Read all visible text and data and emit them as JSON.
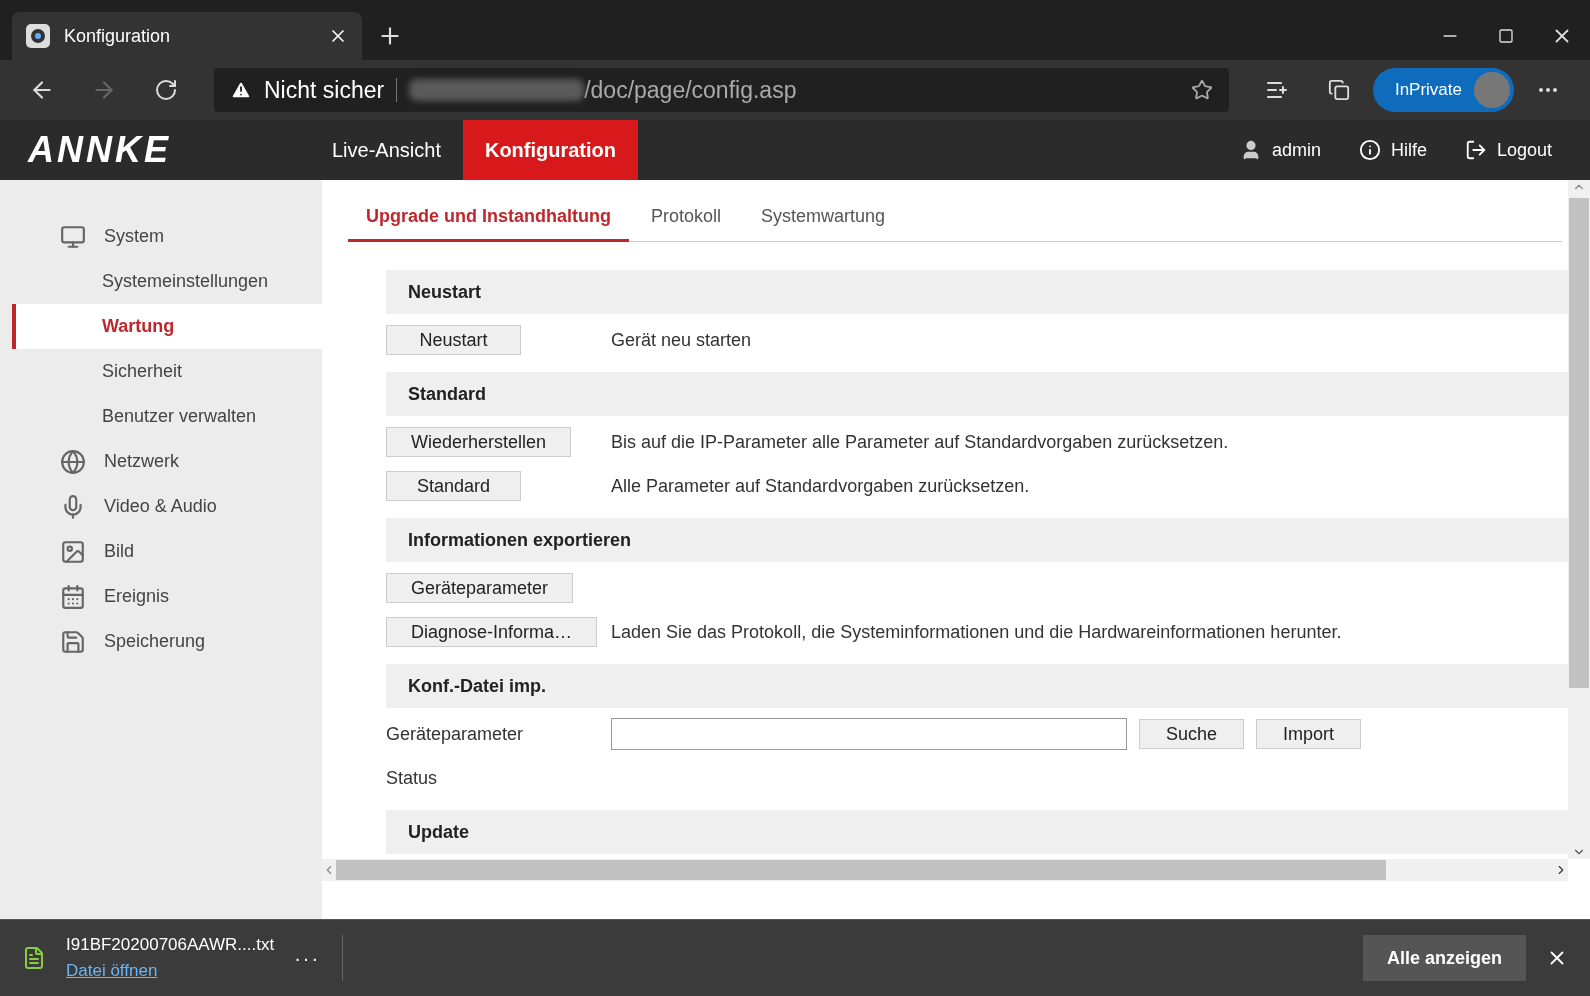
{
  "browser": {
    "tab_title": "Konfiguration",
    "address_path": "/doc/page/config.asp",
    "security": "Nicht sicher",
    "profile": "InPrivate"
  },
  "header": {
    "logo": "ANNKE",
    "nav": [
      {
        "label": "Live-Ansicht",
        "selected": false
      },
      {
        "label": "Konfiguration",
        "selected": true
      }
    ],
    "user": "admin",
    "help": "Hilfe",
    "logout": "Logout"
  },
  "sidebar": {
    "items": [
      {
        "label": "System",
        "selected": false,
        "children": [
          {
            "label": "Systemeinstellungen",
            "selected": false
          },
          {
            "label": "Wartung",
            "selected": true
          },
          {
            "label": "Sicherheit",
            "selected": false
          },
          {
            "label": "Benutzer verwalten",
            "selected": false
          }
        ]
      },
      {
        "label": "Netzwerk",
        "selected": false
      },
      {
        "label": "Video & Audio",
        "selected": false
      },
      {
        "label": "Bild",
        "selected": false
      },
      {
        "label": "Ereignis",
        "selected": false
      },
      {
        "label": "Speicherung",
        "selected": false
      }
    ]
  },
  "tabs": [
    {
      "label": "Upgrade und Instandhaltung",
      "selected": true
    },
    {
      "label": "Protokoll",
      "selected": false
    },
    {
      "label": "Systemwartung",
      "selected": false
    }
  ],
  "sections": [
    {
      "title": "Neustart",
      "rows": [
        {
          "kind": "action",
          "button": "Neustart",
          "description": "Gerät neu starten"
        }
      ]
    },
    {
      "title": "Standard",
      "rows": [
        {
          "kind": "action",
          "button": "Wiederherstellen",
          "description": "Bis auf die IP-Parameter alle Parameter auf Standardvorgaben zurücksetzen."
        },
        {
          "kind": "action",
          "button": "Standard",
          "description": "Alle Parameter auf Standardvorgaben zurücksetzen."
        }
      ]
    },
    {
      "title": "Informationen exportieren",
      "rows": [
        {
          "kind": "action",
          "button": "Geräteparameter"
        },
        {
          "kind": "action",
          "button": "Diagnose-Informa…",
          "description": "Laden Sie das Protokoll, die Systeminformationen und die Hardwareinformationen herunter."
        }
      ]
    },
    {
      "title": "Konf.-Datei imp.",
      "rows": [
        {
          "kind": "file",
          "label": "Geräteparameter",
          "buttons": [
            "Suche",
            "Import"
          ]
        },
        {
          "kind": "status",
          "label": "Status"
        }
      ]
    },
    {
      "title": "Update"
    }
  ],
  "download": {
    "file": "I91BF20200706AAWR....txt",
    "link": "Datei öffnen",
    "more": "···",
    "show_all": "Alle anzeigen"
  }
}
